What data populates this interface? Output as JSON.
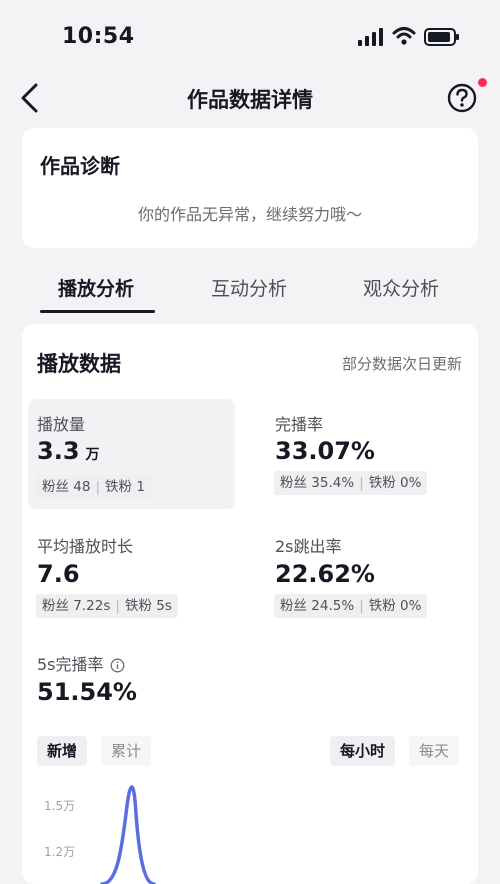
{
  "status_bar": {
    "time": "10:54"
  },
  "nav": {
    "title": "作品数据详情"
  },
  "diagnosis": {
    "title": "作品诊断",
    "message": "你的作品无异常，继续努力哦～"
  },
  "tabs": [
    {
      "label": "播放分析",
      "active": true
    },
    {
      "label": "互动分析",
      "active": false
    },
    {
      "label": "观众分析",
      "active": false
    }
  ],
  "play_data": {
    "title": "播放数据",
    "note": "部分数据次日更新",
    "metrics": {
      "plays": {
        "label": "播放量",
        "value": "3.3",
        "unit": "万",
        "fans": "粉丝 48",
        "iron_fans": "铁粉 1"
      },
      "completion": {
        "label": "完播率",
        "value": "33.07%",
        "fans": "粉丝 35.4%",
        "iron_fans": "铁粉 0%"
      },
      "avg_duration": {
        "label": "平均播放时长",
        "value": "7.6",
        "fans": "粉丝 7.22s",
        "iron_fans": "铁粉 5s"
      },
      "bounce_2s": {
        "label": "2s跳出率",
        "value": "22.62%",
        "fans": "粉丝 24.5%",
        "iron_fans": "铁粉 0%"
      },
      "completion_5s": {
        "label": "5s完播率",
        "value": "51.54%"
      }
    },
    "chips": {
      "new": "新增",
      "cumulative": "累计",
      "hourly": "每小时",
      "daily": "每天"
    }
  },
  "chart_data": {
    "type": "line",
    "y_ticks": [
      "1.5万",
      "1.2万"
    ],
    "series_color": "#5b6ee1"
  },
  "colors": {
    "accent": "#fe2c55",
    "line": "#5b6ee1"
  },
  "icons": [
    "signal-icon",
    "wifi-icon",
    "battery-icon",
    "back-chevron-icon",
    "help-icon",
    "info-icon"
  ]
}
